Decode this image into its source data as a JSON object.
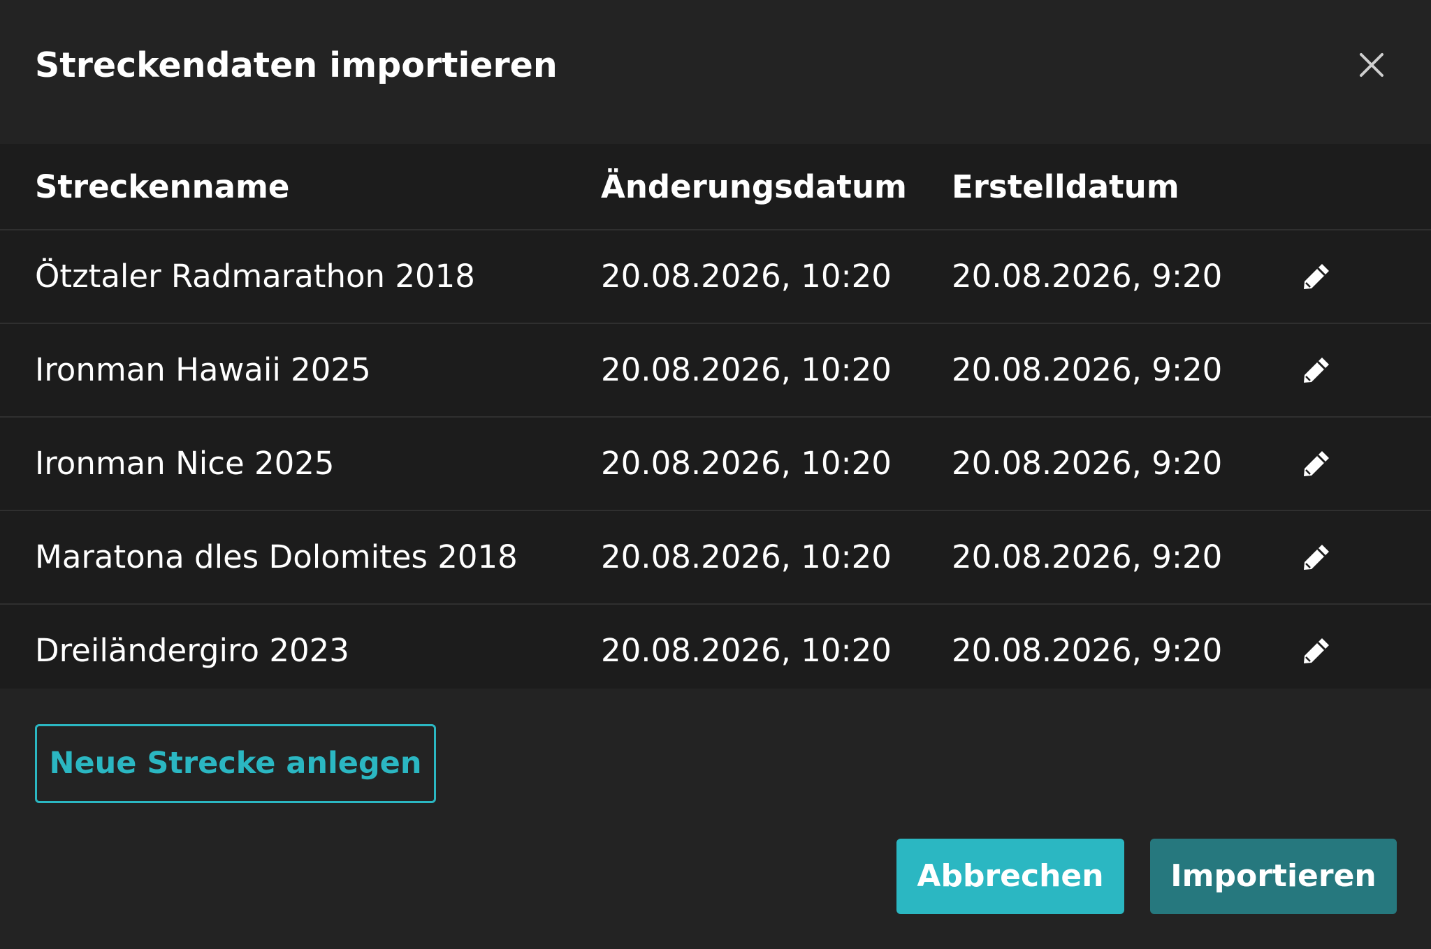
{
  "dialog": {
    "title": "Streckendaten importieren",
    "close_icon": "close-icon"
  },
  "table": {
    "columns": [
      "Streckenname",
      "Änderungsdatum",
      "Erstelldatum"
    ],
    "rows": [
      {
        "name": "Ötztaler Radmarathon 2018",
        "modified": "20.08.2026, 10:20",
        "created": "20.08.2026, 9:20"
      },
      {
        "name": "Ironman Hawaii 2025",
        "modified": "20.08.2026, 10:20",
        "created": "20.08.2026, 9:20"
      },
      {
        "name": "Ironman Nice 2025",
        "modified": "20.08.2026, 10:20",
        "created": "20.08.2026, 9:20"
      },
      {
        "name": "Maratona dles Dolomites 2018",
        "modified": "20.08.2026, 10:20",
        "created": "20.08.2026, 9:20"
      },
      {
        "name": "Dreiländergiro 2023",
        "modified": "20.08.2026, 10:20",
        "created": "20.08.2026, 9:20"
      }
    ],
    "row_icon": "pencil-icon"
  },
  "actions": {
    "new_route_label": "Neue Strecke anlegen",
    "cancel_label": "Abbrechen",
    "import_label": "Importieren"
  },
  "colors": {
    "background": "#232323",
    "table_background": "#1c1c1c",
    "accent": "#2bb7c2",
    "accent_dark": "#26787e"
  }
}
